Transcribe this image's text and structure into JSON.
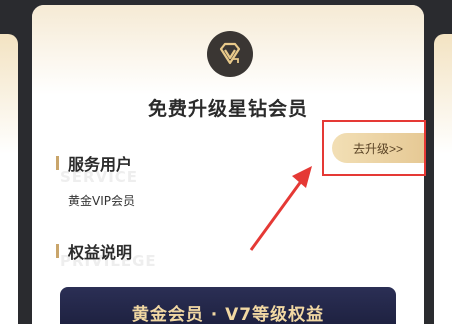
{
  "card": {
    "title": "免费升级星钻会员",
    "sections": {
      "service_user": {
        "title": "服务用户",
        "watermark": "SERVICE",
        "value": "黄金VIP会员"
      },
      "benefits": {
        "title": "权益说明",
        "watermark": "PRIVILEGE"
      }
    },
    "upgrade_button": "去升级>>",
    "banner_text": "黄金会员 · V7等级权益"
  },
  "annotation": {
    "highlight_color": "#e53935",
    "arrow_color": "#e53935"
  },
  "icons": {
    "logo": "diamond-v-logo-icon"
  }
}
